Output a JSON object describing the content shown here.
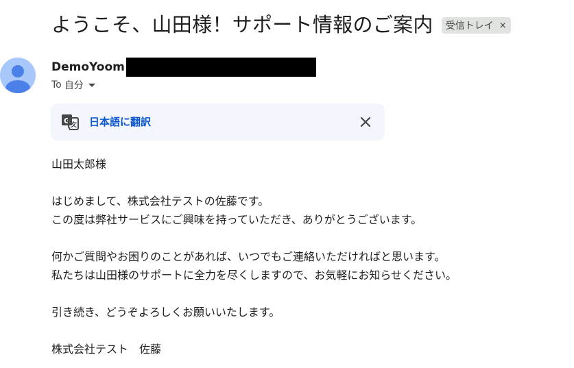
{
  "email": {
    "subject": "ようこそ、山田様！サポート情報のご案内",
    "label_chip": {
      "text": "受信トレイ",
      "remove_glyph": "×"
    },
    "sender": {
      "name": "DemoYoom"
    },
    "recipient": {
      "prefix": "To",
      "name": "自分"
    },
    "translate_bar": {
      "link_label": "日本語に翻訳",
      "icon": "google-translate-icon",
      "close_icon": "close-icon"
    },
    "body": {
      "greeting": "山田太郎様",
      "paragraph1": [
        "はじめまして、株式会社テストの佐藤です。",
        "この度は弊社サービスにご興味を持っていただき、ありがとうございます。"
      ],
      "paragraph2": [
        "何かご質問やお困りのことがあれば、いつでもご連絡いただければと思います。",
        "私たちは山田様のサポートに全力を尽くしますので、お気軽にお知らせください。"
      ],
      "closing": "引き続き、どうぞよろしくお願いいたします。",
      "signature": "株式会社テスト　佐藤"
    }
  },
  "colors": {
    "avatar_bg": "#a8c7fa",
    "avatar_fg": "#4a80e8",
    "link": "#0b57d0",
    "translate_bar_bg": "#f3f6fc",
    "chip_bg": "#e1e3e1",
    "text": "#1f1f1f",
    "redaction": "#000000"
  }
}
